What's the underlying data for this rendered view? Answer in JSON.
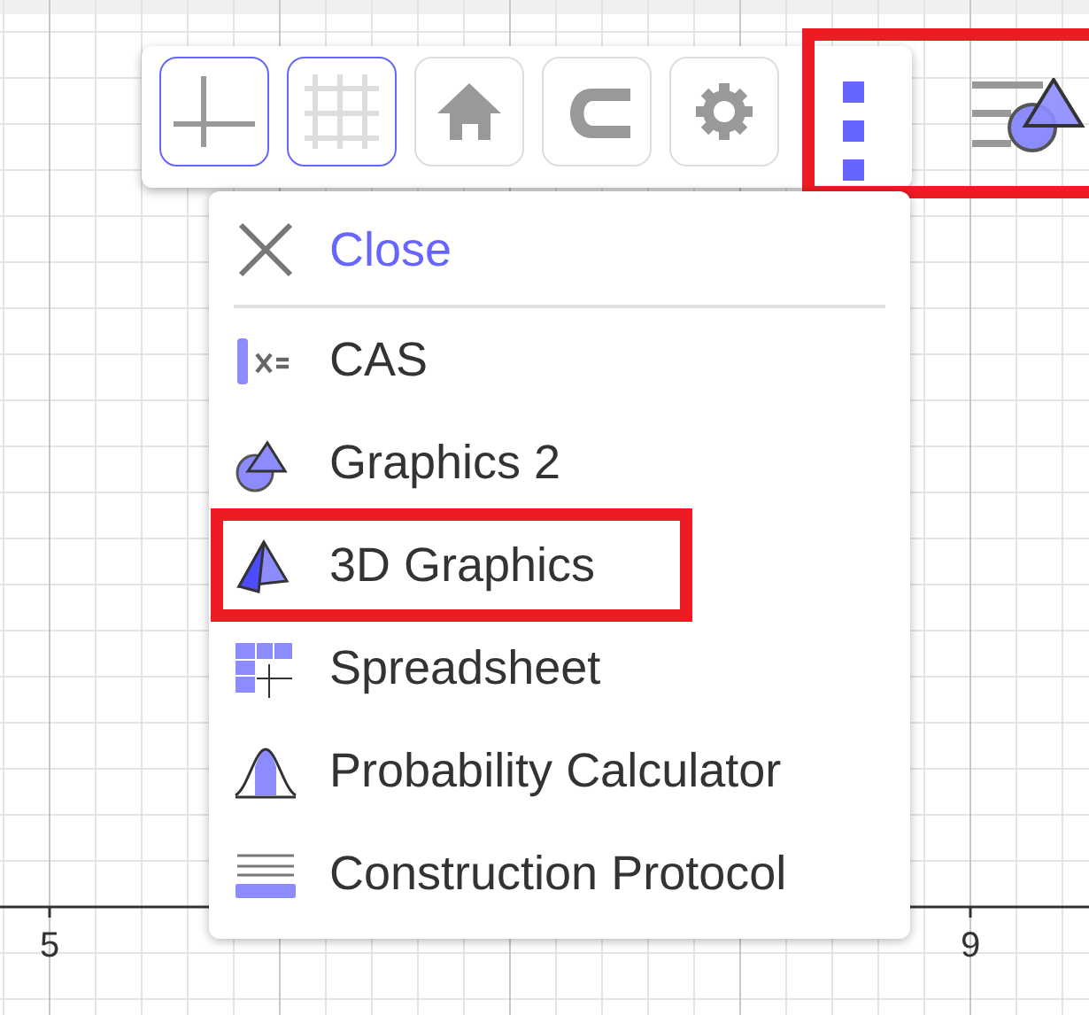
{
  "toolbar": {
    "buttons": [
      {
        "kind": "axes",
        "on": true
      },
      {
        "kind": "grid",
        "on": true
      },
      {
        "kind": "home",
        "on": false
      },
      {
        "kind": "snap",
        "on": false
      },
      {
        "kind": "settings",
        "on": false
      }
    ],
    "highlighted": true
  },
  "menu": {
    "close": "Close",
    "items": [
      {
        "kind": "cas",
        "label": "CAS",
        "highlighted": false
      },
      {
        "kind": "graphics2",
        "label": "Graphics 2",
        "highlighted": false
      },
      {
        "kind": "graphics3d",
        "label": "3D Graphics",
        "highlighted": true
      },
      {
        "kind": "spreadsheet",
        "label": "Spreadsheet",
        "highlighted": false
      },
      {
        "kind": "probability",
        "label": "Probability Calculator",
        "highlighted": false
      },
      {
        "kind": "protocol",
        "label": "Construction Protocol",
        "highlighted": false
      }
    ]
  },
  "axis": {
    "labels": [
      "5",
      "9"
    ]
  }
}
